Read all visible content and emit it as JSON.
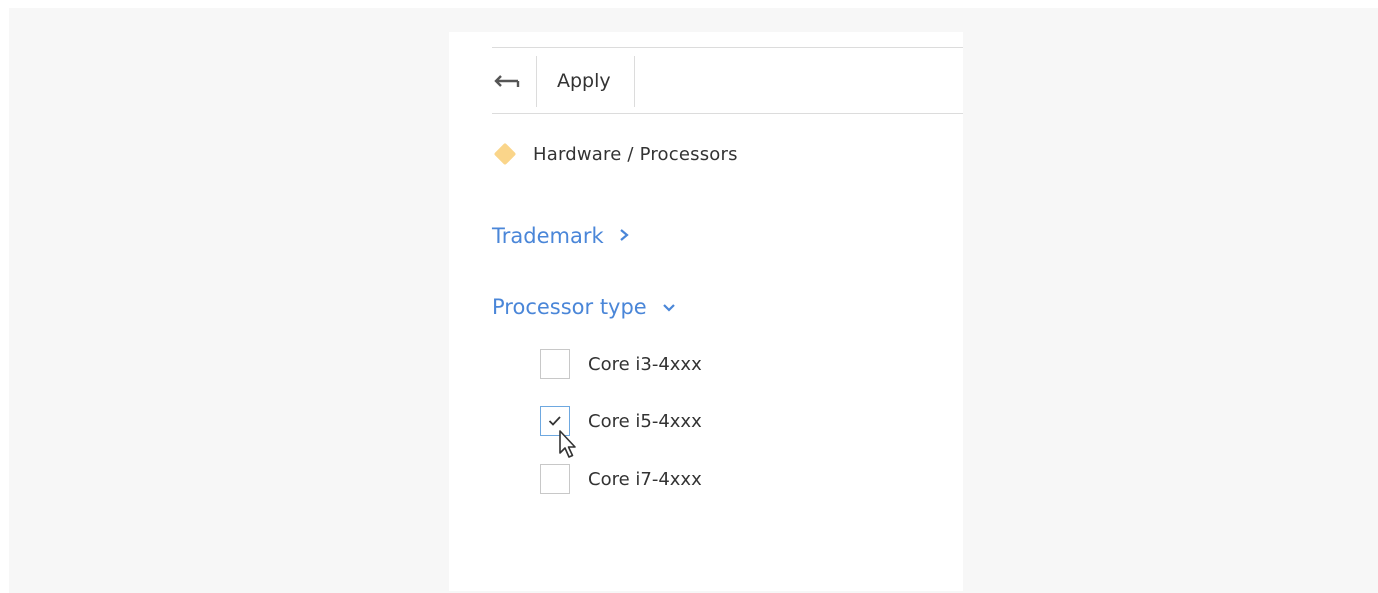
{
  "toolbar": {
    "back_icon": "back-arrow-icon",
    "apply_label": "Apply"
  },
  "breadcrumb": {
    "icon": "diamond-icon",
    "icon_color": "#fad58a",
    "text": "Hardware / Processors"
  },
  "sections": [
    {
      "label": "Trademark",
      "expanded": false,
      "icon": "chevron-right-icon"
    },
    {
      "label": "Processor type",
      "expanded": true,
      "icon": "chevron-down-icon"
    }
  ],
  "options": [
    {
      "label": "Core i3-4xxx",
      "checked": false
    },
    {
      "label": "Core i5-4xxx",
      "checked": true
    },
    {
      "label": "Core i7-4xxx",
      "checked": false
    }
  ],
  "colors": {
    "accent": "#4a86d8",
    "background": "#f7f7f7",
    "panel": "#ffffff"
  }
}
